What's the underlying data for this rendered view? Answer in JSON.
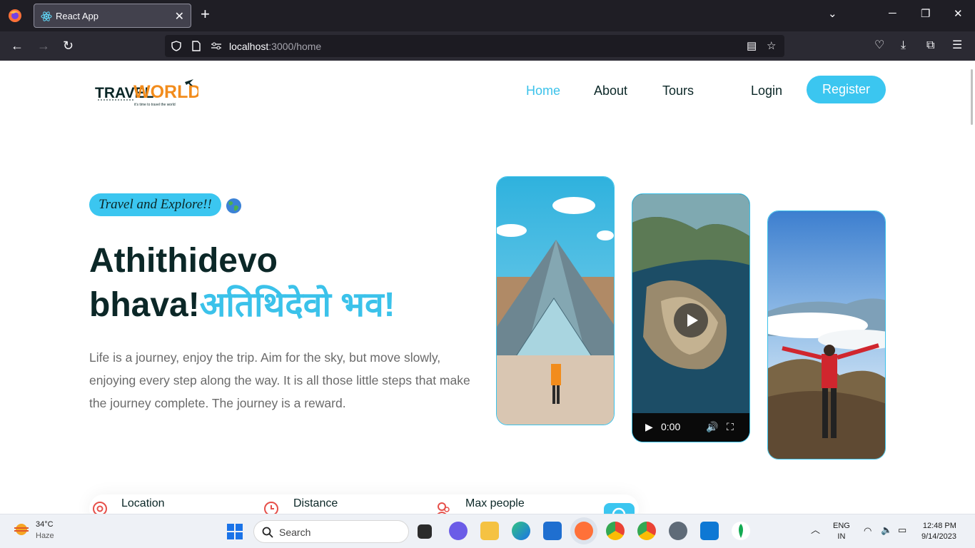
{
  "browser": {
    "tab_title": "React App",
    "url_host": "localhost",
    "url_path": ":3000/home"
  },
  "header": {
    "logo_text_1": "TRAVEL",
    "logo_text_2": "WORLD",
    "logo_tagline": "it's time to travel the world",
    "nav": [
      {
        "label": "Home"
      },
      {
        "label": "About"
      },
      {
        "label": "Tours"
      }
    ],
    "login_label": "Login",
    "register_label": "Register"
  },
  "hero": {
    "badge": "Travel and Explore!!",
    "title_line1": "Athithidevo",
    "title_line2": "bhava!",
    "title_highlight": "अतिथिदेवो भव!",
    "description": "Life is a journey, enjoy the trip. Aim for the sky, but move slowly, enjoying every step along the way. It is all those little steps that make the journey complete. The journey is a reward.",
    "video_time": "0:00"
  },
  "search": {
    "location_label": "Location",
    "distance_label": "Distance",
    "max_people_label": "Max people"
  },
  "taskbar": {
    "temperature": "34°C",
    "weather": "Haze",
    "search_label": "Search",
    "lang1": "ENG",
    "lang2": "IN",
    "time": "12:48 PM",
    "date": "9/14/2023"
  },
  "colors": {
    "accent": "#3bc6f0",
    "heading": "#0b2727",
    "logo_orange": "#f28c1c"
  }
}
